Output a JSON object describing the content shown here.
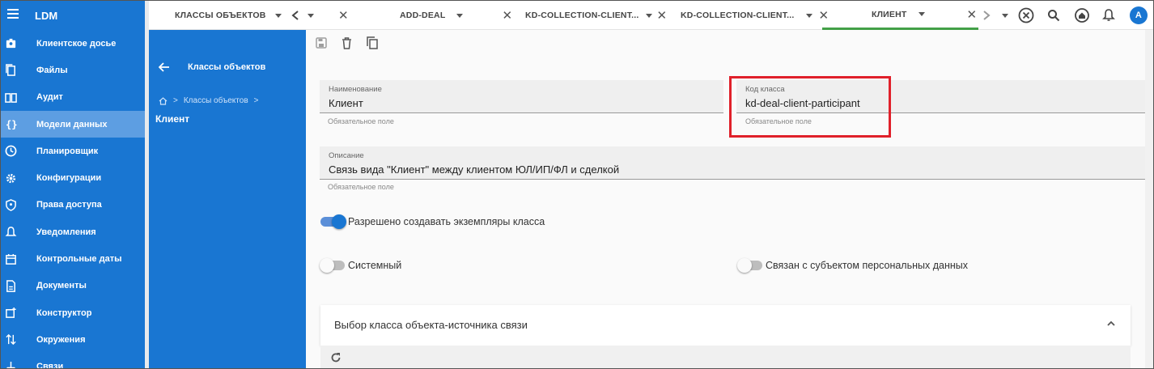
{
  "app": {
    "title": "LDM"
  },
  "nav": {
    "items": [
      {
        "label": "Клиентское досье",
        "icon": "client-dossier-icon"
      },
      {
        "label": "Файлы",
        "icon": "files-icon"
      },
      {
        "label": "Аудит",
        "icon": "audit-icon"
      },
      {
        "label": "Модели данных",
        "icon": "braces-icon"
      },
      {
        "label": "Планировщик",
        "icon": "clock-icon"
      },
      {
        "label": "Конфигурации",
        "icon": "gear-icon"
      },
      {
        "label": "Права доступа",
        "icon": "shield-icon"
      },
      {
        "label": "Уведомления",
        "icon": "bell-icon"
      },
      {
        "label": "Контрольные даты",
        "icon": "calendar-icon"
      },
      {
        "label": "Документы",
        "icon": "document-icon"
      },
      {
        "label": "Конструктор",
        "icon": "constructor-icon"
      },
      {
        "label": "Окружения",
        "icon": "environments-icon"
      },
      {
        "label": "Связи",
        "icon": "links-icon"
      }
    ]
  },
  "tabs": [
    {
      "label": "КЛАССЫ ОБЪЕКТОВ"
    },
    {
      "label": "ADD-DEAL"
    },
    {
      "label": "KD-COLLECTION-CLIENT..."
    },
    {
      "label": "KD-COLLECTION-CLIENT..."
    },
    {
      "label": "КЛИЕНТ"
    }
  ],
  "header": {
    "avatar": "A"
  },
  "panel": {
    "back_title": "Классы объектов",
    "breadcrumb": "Классы объектов",
    "current": "Клиент"
  },
  "form": {
    "name_label": "Наименование",
    "name_value": "Клиент",
    "name_hint": "Обязательное поле",
    "code_label": "Код класса",
    "code_value": "kd-deal-client-participant",
    "code_hint": "Обязательное поле",
    "desc_label": "Описание",
    "desc_value": "Связь вида \"Клиент\" между клиентом ЮЛ/ИП/ФЛ и сделкой",
    "desc_hint": "Обязательное поле",
    "toggle_instances": "Разрешено создавать экземпляры класса",
    "toggle_instances_on": true,
    "toggle_system": "Системный",
    "toggle_system_on": false,
    "toggle_personal": "Связан с субъектом персональных данных",
    "toggle_personal_on": false
  },
  "expander": {
    "title": "Выбор класса объекта-источника связи"
  },
  "colors": {
    "primary": "#1976d2",
    "active_tab": "#43a047",
    "highlight": "#e0202a"
  }
}
